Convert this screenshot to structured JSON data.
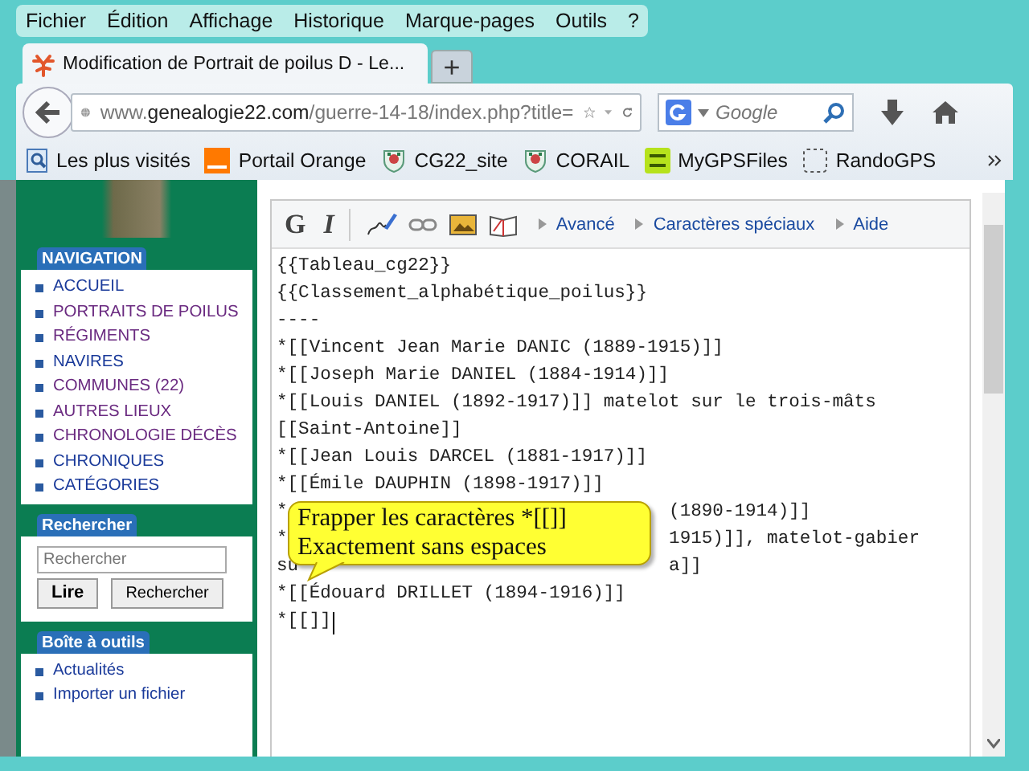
{
  "menu": [
    "Fichier",
    "Édition",
    "Affichage",
    "Historique",
    "Marque-pages",
    "Outils",
    "?"
  ],
  "tab": {
    "title": "Modification de Portrait de poilus D - Le...",
    "new_tab": "+"
  },
  "address": {
    "prefix": "www.",
    "domain": "genealogie22.com",
    "path": "/guerre-14-18/index.php?title="
  },
  "search": {
    "placeholder": "Google"
  },
  "bookmarks": [
    {
      "label": "Les plus visités",
      "kind": "history"
    },
    {
      "label": "Portail Orange",
      "kind": "orange"
    },
    {
      "label": "CG22_site",
      "kind": "crest"
    },
    {
      "label": "CORAIL",
      "kind": "crest"
    },
    {
      "label": "MyGPSFiles",
      "kind": "gps"
    },
    {
      "label": "RandoGPS",
      "kind": "blank"
    }
  ],
  "sidebar": {
    "navigation": {
      "title": "NAVIGATION",
      "items": [
        {
          "label": "ACCUEIL",
          "visited": false
        },
        {
          "label": "PORTRAITS DE POILUS",
          "visited": true
        },
        {
          "label": "RÉGIMENTS",
          "visited": true
        },
        {
          "label": "NAVIRES",
          "visited": false
        },
        {
          "label": "COMMUNES (22)",
          "visited": true
        },
        {
          "label": "AUTRES LIEUX",
          "visited": true
        },
        {
          "label": "CHRONOLOGIE DÉCÈS",
          "visited": true
        },
        {
          "label": "CHRONIQUES",
          "visited": false
        },
        {
          "label": "CATÉGORIES",
          "visited": false
        }
      ]
    },
    "search": {
      "title": "Rechercher",
      "placeholder": "Rechercher",
      "buttons": [
        "Lire",
        "Rechercher"
      ]
    },
    "toolbox": {
      "title": "Boîte à outils",
      "items": [
        {
          "label": "Actualités",
          "visited": false
        },
        {
          "label": "Importer un fichier",
          "visited": false
        }
      ]
    }
  },
  "editor": {
    "toolbar": {
      "bold": "G",
      "italic": "I",
      "links": [
        "Avancé",
        "Caractères spéciaux",
        "Aide"
      ]
    },
    "lines": [
      {
        "text": "{{Tableau_cg22}}"
      },
      {
        "text": "{{Classement_alphabétique_poilus}}"
      },
      {
        "text": "----"
      },
      {
        "text": "*[[Vincent Jean Marie DANIC (1889-1915)]]"
      },
      {
        "text": "*[[Joseph Marie DANIEL (1884-1914)]]"
      },
      {
        "text": "*[[Louis DANIEL (1892-1917)]] matelot sur le trois-mâts"
      },
      {
        "text": "[[Saint-Antoine]]"
      },
      {
        "text": "*[[Jean Louis DARCEL (1881-1917)]]"
      },
      {
        "text": "*[[Émile DAUPHIN (1898-1917)]]"
      },
      {
        "start": "*",
        "end": "(1890-1914)]]"
      },
      {
        "start": "*",
        "end": "1915)]], matelot-gabier"
      },
      {
        "start": "su",
        "end": "a]]"
      },
      {
        "text": "*[[Édouard DRILLET (1894-1916)]]"
      },
      {
        "text": "*[[]]",
        "cursor": true
      }
    ],
    "callout": [
      "Frapper les caractères *[[]]",
      "Exactement sans espaces"
    ]
  }
}
